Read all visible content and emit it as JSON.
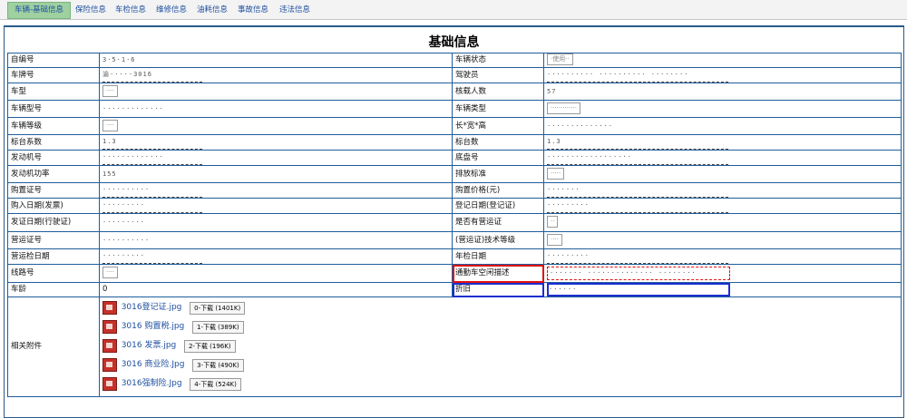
{
  "tabs": [
    {
      "label": "车辆-基础信息"
    },
    {
      "label": "保险信息"
    },
    {
      "label": "车检信息"
    },
    {
      "label": "维修信息"
    },
    {
      "label": "油耗信息"
    },
    {
      "label": "事故信息"
    },
    {
      "label": "违法信息"
    }
  ],
  "title": "基础信息",
  "rows": [
    {
      "l1": "自编号",
      "v1": "3·5·1·6",
      "l2": "车辆状态",
      "v2": "·使用··"
    },
    {
      "l1": "车牌号",
      "v1": "渝·····3016",
      "l2": "驾驶员",
      "v2": "·········· ·········· ········"
    },
    {
      "l1": "车型",
      "v1": "····",
      "l2": "核载人数",
      "v2": "57"
    },
    {
      "l1": "车辆型号",
      "v1": "·············",
      "l2": "车辆类型",
      "v2": "·············"
    },
    {
      "l1": "车辆等级",
      "v1": "····",
      "l2": "长*宽*高",
      "v2": "··············"
    },
    {
      "l1": "标台系数",
      "v1": "1.3",
      "l2": "标台数",
      "v2": "1.3"
    },
    {
      "l1": "发动机号",
      "v1": "·············",
      "l2": "底盘号",
      "v2": "··················"
    },
    {
      "l1": "发动机功率",
      "v1": "155",
      "l2": "排放标准",
      "v2": "·····"
    },
    {
      "l1": "购置证号",
      "v1": "··········",
      "l2": "购置价格(元)",
      "v2": "·······"
    },
    {
      "l1": "购入日期(发票)",
      "v1": "·········",
      "l2": "登记日期(登记证)",
      "v2": "·········"
    },
    {
      "l1": "发证日期(行驶证)",
      "v1": "·········",
      "l2": "是否有营运证",
      "v2": "··"
    },
    {
      "l1": "营运证号",
      "v1": "··········",
      "l2": "(营运证)技术等级",
      "v2": "····"
    },
    {
      "l1": "营运检日期",
      "v1": "·········",
      "l2": "年检日期",
      "v2": "·········"
    },
    {
      "l1": "线路号",
      "v1": "····",
      "l2": "通勤车空闲描述",
      "v2": "······· ·············· ········"
    },
    {
      "l1": "车龄",
      "v1": "0",
      "l2": "折旧",
      "v2": "······"
    }
  ],
  "attachments": {
    "label": "相关附件",
    "files": [
      {
        "name": "3016登记证.jpg",
        "download": "0-下载 (1401K)"
      },
      {
        "name": "3016 购置税.jpg",
        "download": "1-下载 (389K)"
      },
      {
        "name": "3016 发票.jpg",
        "download": "2-下载 (196K)"
      },
      {
        "name": "3016 商业险.Jpg",
        "download": "3-下载 (490K)"
      },
      {
        "name": "3016强制险.Jpg",
        "download": "4-下载 (524K)"
      }
    ]
  },
  "colors": {
    "active_tab": "#9ed0a0",
    "border": "#1f5e9c",
    "highlight_red": "#e01010",
    "highlight_blue": "#1a2fd0"
  }
}
